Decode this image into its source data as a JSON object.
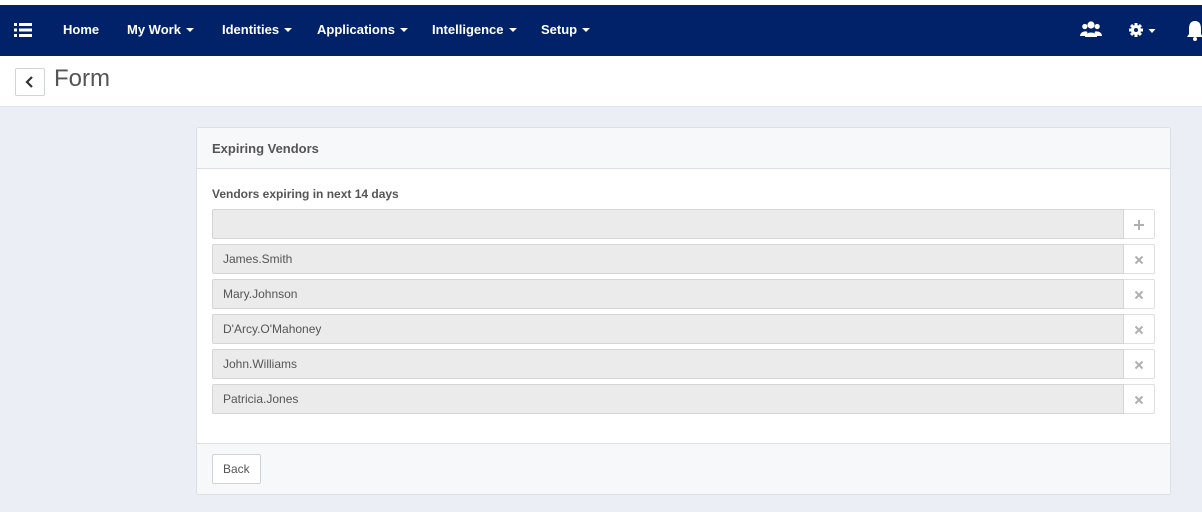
{
  "navbar": {
    "background": "#012169",
    "items": [
      {
        "label": "Home",
        "dropdown": false
      },
      {
        "label": "My Work",
        "dropdown": true
      },
      {
        "label": "Identities",
        "dropdown": true
      },
      {
        "label": "Applications",
        "dropdown": true
      },
      {
        "label": "Intelligence",
        "dropdown": true
      },
      {
        "label": "Setup",
        "dropdown": true
      }
    ],
    "right_icons": [
      "users-icon",
      "gear-icon",
      "bell-icon"
    ]
  },
  "page": {
    "title": "Form"
  },
  "form": {
    "title": "Expiring Vendors",
    "field_label": "Vendors expiring in next 14 days",
    "new_entry_value": "",
    "vendors": [
      "James.Smith",
      "Mary.Johnson",
      "D'Arcy.O'Mahoney",
      "John.Williams",
      "Patricia.Jones"
    ],
    "back_label": "Back"
  }
}
